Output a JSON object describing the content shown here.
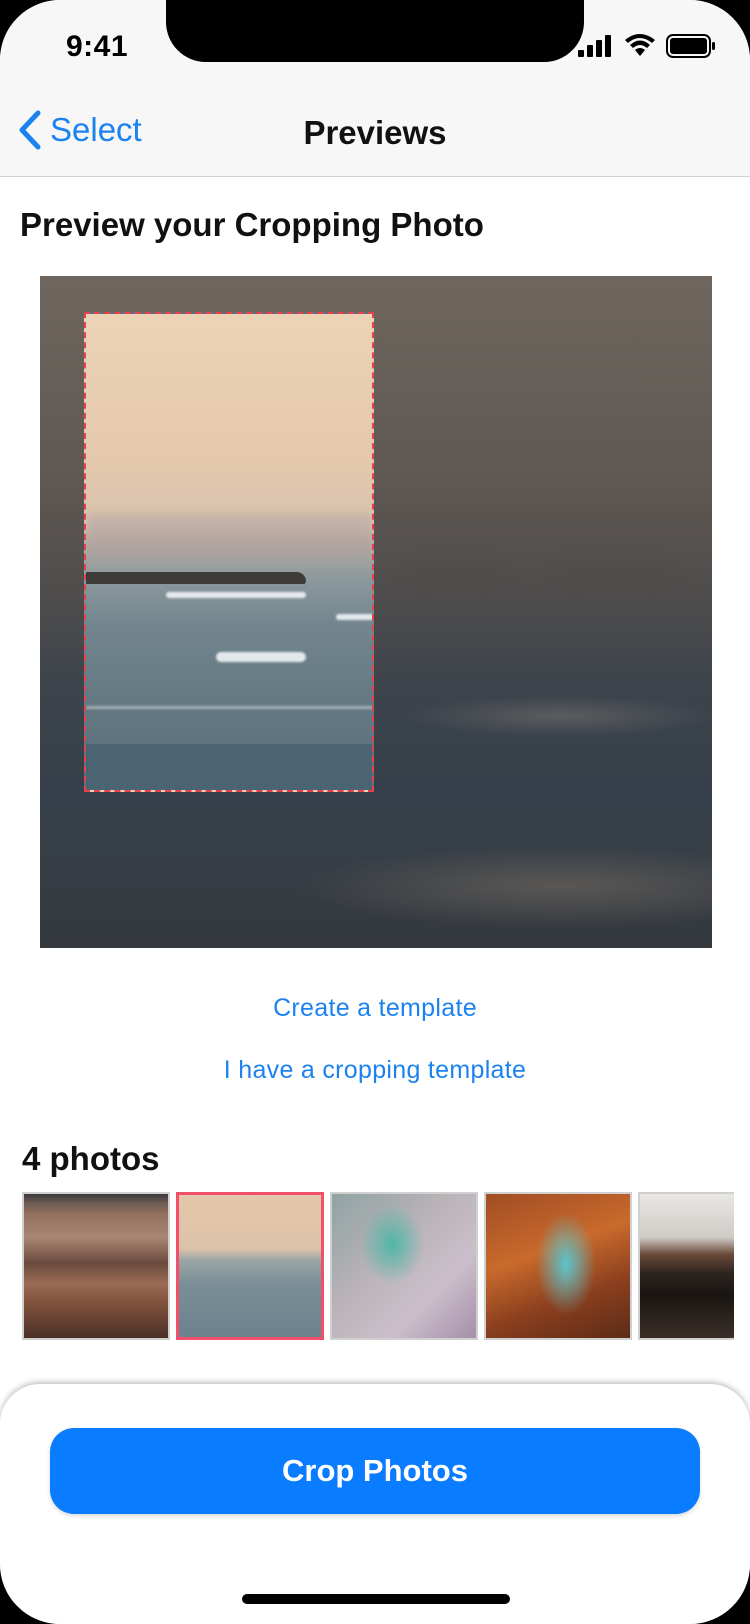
{
  "status_bar": {
    "time": "9:41"
  },
  "nav": {
    "back_label": "Select",
    "title": "Previews"
  },
  "preview": {
    "title": "Preview your Cropping Photo"
  },
  "actions": {
    "create_template": "Create a template",
    "have_template": "I have a cropping template"
  },
  "photos": {
    "count_label": "4 photos",
    "items": [
      {
        "name": "canyon-photo",
        "selected": false
      },
      {
        "name": "beach-waves-photo",
        "selected": true
      },
      {
        "name": "aerial-river-photo",
        "selected": false
      },
      {
        "name": "aerial-lake-photo",
        "selected": false
      },
      {
        "name": "mountain-lake-photo",
        "selected": false
      }
    ]
  },
  "bottom": {
    "crop_button": "Crop Photos"
  },
  "colors": {
    "accent": "#0a7cff",
    "link": "#1b82f0",
    "crop_border": "#e8404d",
    "selected_border": "#f0506a"
  }
}
